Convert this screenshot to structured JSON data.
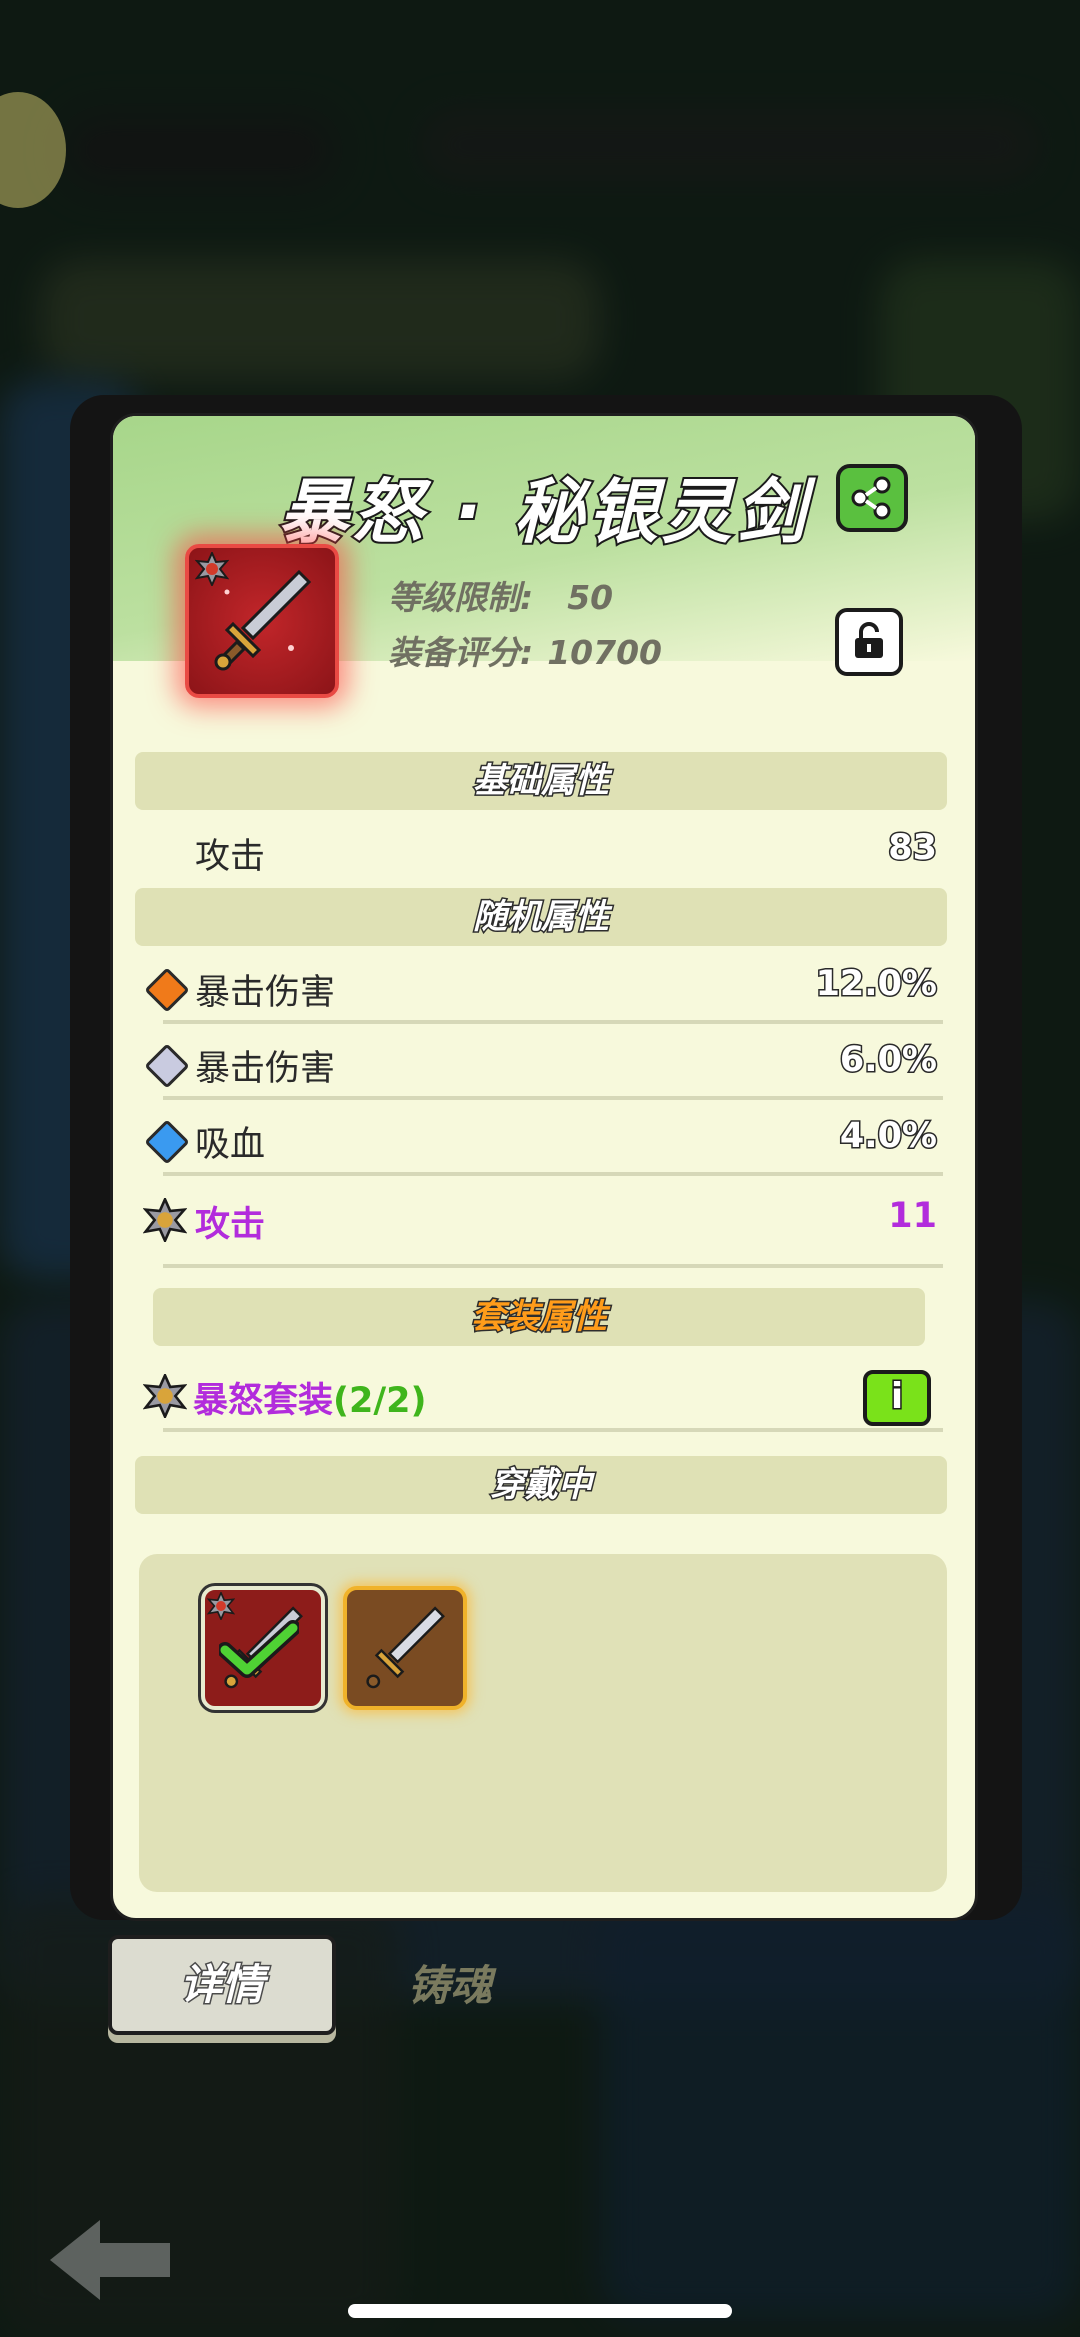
{
  "item": {
    "name": "暴怒 · 秘银灵剑",
    "level_label": "等级限制:",
    "level_value": "50",
    "score_label": "装备评分:",
    "score_value": "10700"
  },
  "sections": {
    "base": "基础属性",
    "random": "随机属性",
    "set": "套装属性",
    "wearing": "穿戴中"
  },
  "base_stats": [
    {
      "label": "攻击",
      "value": "83"
    }
  ],
  "random_stats": [
    {
      "label": "暴击伤害",
      "value": "12.0%",
      "gem_color": "#f07a1a"
    },
    {
      "label": "暴击伤害",
      "value": "6.0%",
      "gem_color": "#c9cbe0"
    },
    {
      "label": "吸血",
      "value": "4.0%",
      "gem_color": "#3a9af0"
    },
    {
      "label": "攻击",
      "value": "11",
      "icon": "rage-badge-icon"
    }
  ],
  "set_bonus": {
    "name": "暴怒套装",
    "count": "(2/2)",
    "info_glyph": "i"
  },
  "tabs": {
    "detail": "详情",
    "forge": "铸魂"
  },
  "colors": {
    "purple": "#b22cdc",
    "green": "#3fb51c",
    "card_bg": "#f7f9dc"
  }
}
